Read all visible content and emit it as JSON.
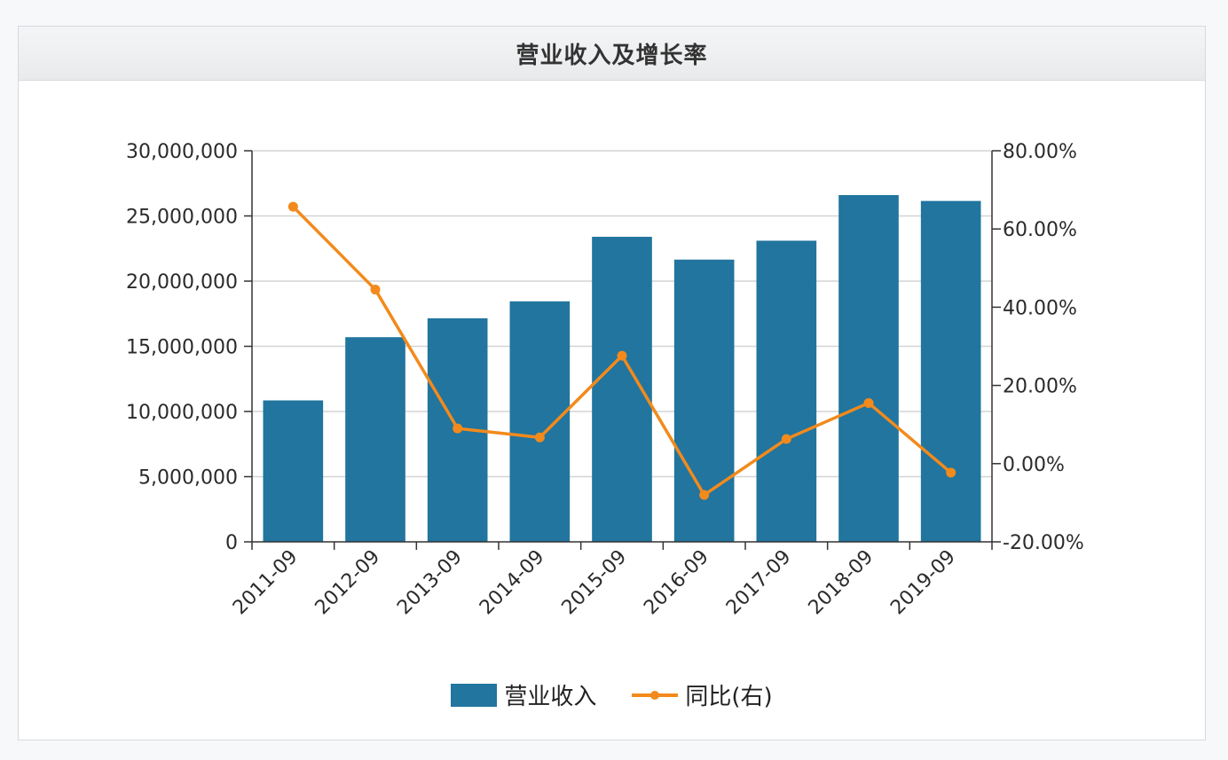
{
  "panel": {
    "title": "营业收入及增长率"
  },
  "chart_data": {
    "type": "bar",
    "title": "营业收入及增长率",
    "categories": [
      "2011-09",
      "2012-09",
      "2013-09",
      "2014-09",
      "2015-09",
      "2016-09",
      "2017-09",
      "2018-09",
      "2019-09"
    ],
    "series": [
      {
        "name": "营业收入",
        "type": "bar",
        "axis": "left",
        "color": "#21759e",
        "values": [
          10850000,
          15700000,
          17150000,
          18450000,
          23400000,
          21650000,
          23100000,
          26600000,
          26150000
        ]
      },
      {
        "name": "同比(右)",
        "type": "line",
        "axis": "right",
        "color": "#f28a1c",
        "values": [
          65.7,
          44.5,
          9.0,
          6.7,
          27.6,
          -8.0,
          6.3,
          15.5,
          -2.3
        ]
      }
    ],
    "y_left": {
      "ylim": [
        0,
        30000000
      ],
      "ticks": [
        0,
        5000000,
        10000000,
        15000000,
        20000000,
        25000000,
        30000000
      ],
      "tick_labels": [
        "0",
        "5,000,000",
        "10,000,000",
        "15,000,000",
        "20,000,000",
        "25,000,000",
        "30,000,000"
      ]
    },
    "y_right": {
      "ylim": [
        -20,
        80
      ],
      "ticks": [
        -20,
        0,
        20,
        40,
        60,
        80
      ],
      "tick_labels": [
        "-20.00%",
        "0.00%",
        "20.00%",
        "40.00%",
        "60.00%",
        "80.00%"
      ]
    },
    "grid": true,
    "legend": "bottom",
    "legend_entries": [
      "营业收入",
      "同比(右)"
    ]
  }
}
